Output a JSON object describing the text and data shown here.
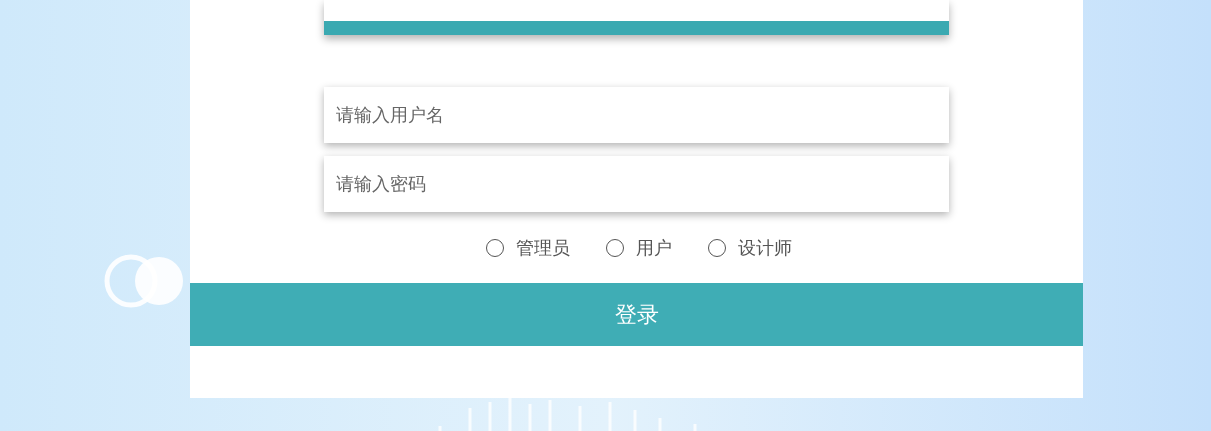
{
  "inputs": [
    {
      "placeholder": "请输入用户名"
    },
    {
      "placeholder": "请输入密码"
    }
  ],
  "roles": [
    {
      "label": "管理员",
      "selected": false
    },
    {
      "label": "用户",
      "selected": false
    },
    {
      "label": "设计师",
      "selected": false
    }
  ],
  "login_button": "登录"
}
